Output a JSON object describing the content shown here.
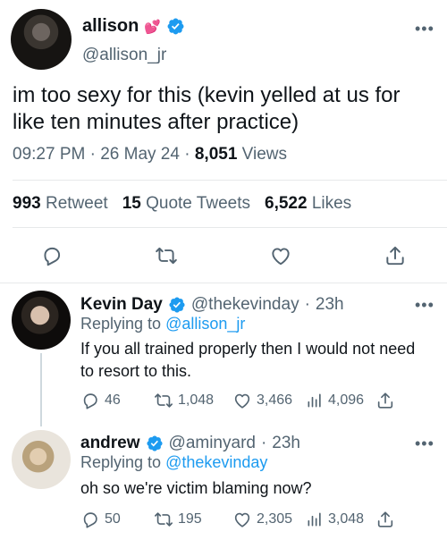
{
  "main_tweet": {
    "display_name": "allison",
    "emoji": "💕",
    "handle": "@allison_jr",
    "text": "im too sexy for this (kevin yelled at us for like ten minutes after practice)",
    "time": "09:27 PM",
    "date": "26 May 24",
    "views_count": "8,051",
    "views_label": "Views",
    "retweets_count": "993",
    "retweets_label": "Retweet",
    "quotes_count": "15",
    "quotes_label": "Quote Tweets",
    "likes_count": "6,522",
    "likes_label": "Likes",
    "more": "•••"
  },
  "replies": [
    {
      "display_name": "Kevin Day",
      "handle": "@thekevinday",
      "age": "23h",
      "replying_prefix": "Replying to",
      "replying_to": "@allison_jr",
      "text": "If you all trained properly then I would not need to resort to this.",
      "replies": "46",
      "retweets": "1,048",
      "likes": "3,466",
      "views": "4,096",
      "more": "•••"
    },
    {
      "display_name": "andrew",
      "handle": "@aminyard",
      "age": "23h",
      "replying_prefix": "Replying to",
      "replying_to": "@thekevinday",
      "text": "oh so we're victim blaming now?",
      "replies": "50",
      "retweets": "195",
      "likes": "2,305",
      "views": "3,048",
      "more": "•••"
    }
  ],
  "icons": [
    "verified-badge-icon",
    "reply-icon",
    "retweet-icon",
    "like-icon",
    "share-icon",
    "views-icon",
    "more-icon"
  ],
  "colors": {
    "accent": "#1d9bf0",
    "secondary_text": "#536471",
    "divider": "#e7e9ea"
  }
}
